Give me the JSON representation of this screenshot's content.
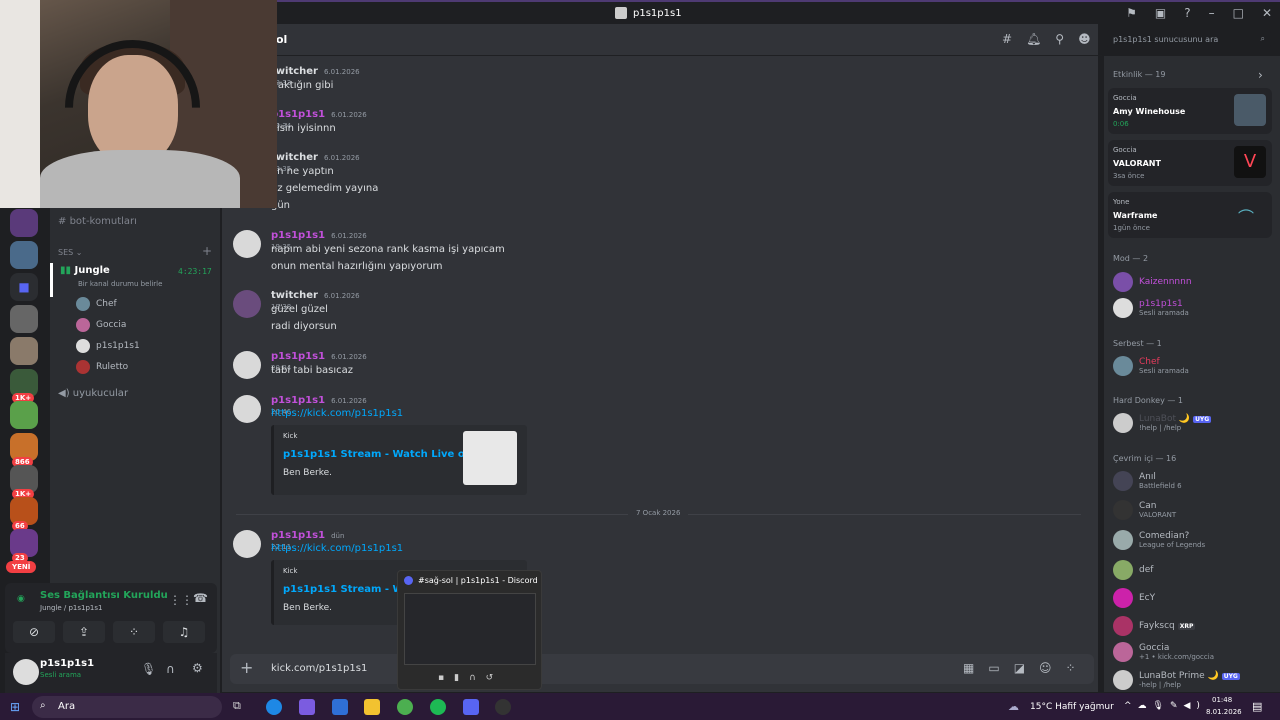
{
  "window": {
    "title": "p1s1p1s1"
  },
  "channel": {
    "name": "ol"
  },
  "search": {
    "placeholder": "p1s1p1s1 sunucusunu ara"
  },
  "sidebar": {
    "text_channel": "bot-komutları",
    "voice_category": "SES",
    "active_voice": {
      "name": "Jungle",
      "timer": "4:23:17",
      "status_prompt": "Bir kanal durumu belirle"
    },
    "voice_users": [
      "Chef",
      "Goccia",
      "p1s1p1s1",
      "Ruletto"
    ],
    "other_voice": "uyukucular",
    "new_label": "YENİ",
    "server_badges": [
      "1K+",
      "1K+",
      "866",
      "1K+",
      "66",
      "23"
    ]
  },
  "voice_status": {
    "title": "Ses Bağlantısı Kuruldu",
    "subtitle": "Jungle / p1s1p1s1"
  },
  "user": {
    "name": "p1s1p1s1",
    "status": "Sesli arama"
  },
  "messages": [
    {
      "author": "twitcher",
      "time": "6.01.2026 19:33",
      "color": "#dbdee1",
      "lines": [
        "ıraktığın gibi"
      ]
    },
    {
      "author": "p1s1p1s1",
      "time": "6.01.2026 19:34",
      "color": "#c150d9",
      "lines": [
        "yisin iyisinnn"
      ]
    },
    {
      "author": "twitcher",
      "time": "6.01.2026 19:35",
      "color": "#dbdee1",
      "lines": [
        "en ne yaptın",
        "üz gelemedim yayına",
        "ğün"
      ]
    },
    {
      "author": "p1s1p1s1",
      "time": "6.01.2026 19:35",
      "color": "#c150d9",
      "lines": [
        "napım abi yeni sezona rank kasma işi yapıcam",
        "onun mental hazırlığını yapıyorum"
      ]
    },
    {
      "author": "twitcher",
      "time": "6.01.2026 19:38",
      "color": "#dbdee1",
      "lines": [
        "güzel güzel",
        "radi diyorsun"
      ]
    },
    {
      "author": "p1s1p1s1",
      "time": "6.01.2026 20:04",
      "color": "#c150d9",
      "lines": [
        "tabi tabi basıcaz"
      ]
    },
    {
      "author": "p1s1p1s1",
      "time": "6.01.2026 20:46",
      "color": "#c150d9",
      "link": "https://kick.com/p1s1p1s1",
      "embed": {
        "provider": "Kick",
        "title": "p1s1p1s1 Stream - Watch Live on Kick",
        "desc": "Ben Berke."
      }
    },
    {
      "author": "p1s1p1s1",
      "time": "dün 22:11",
      "color": "#c150d9",
      "link": "https://kick.com/p1s1p1s1",
      "embed": {
        "provider": "Kick",
        "title": "p1s1p1s1 Stream - Watch L",
        "desc": "Ben Berke."
      }
    }
  ],
  "date_divider": "7 Ocak 2026",
  "input": {
    "value": "kick.com/p1s1p1s1"
  },
  "activity": {
    "header": "Etkinlik — 19",
    "items": [
      {
        "user": "Goccia",
        "title": "Amy Winehouse",
        "sub": "0:06"
      },
      {
        "user": "Goccia",
        "title": "VALORANT",
        "sub": "3sa önce"
      },
      {
        "user": "Yone",
        "title": "Warframe",
        "sub": "1gün önce"
      }
    ]
  },
  "member_sections": [
    {
      "header": "Mod — 2",
      "members": [
        {
          "name": "Kaizennnnn",
          "color": "#c150d9",
          "status": ""
        },
        {
          "name": "p1s1p1s1",
          "color": "#c150d9",
          "status": "Sesli aramada"
        }
      ]
    },
    {
      "header": "Serbest — 1",
      "members": [
        {
          "name": "Chef",
          "color": "#e63b5c",
          "status": "Sesli aramada"
        }
      ]
    },
    {
      "header": "Hard Donkey — 1",
      "members": [
        {
          "name": "LunaBot 🌙",
          "color": "#4e5058",
          "status": "!help | /help",
          "tag": "UYG"
        }
      ]
    },
    {
      "header": "Çevrim içi — 16",
      "members": [
        {
          "name": "Anıl",
          "color": "#b5bac1",
          "status": "Battlefield 6"
        },
        {
          "name": "Can",
          "color": "#b5bac1",
          "status": "VALORANT"
        },
        {
          "name": "Comedian?",
          "color": "#b5bac1",
          "status": "League of Legends"
        },
        {
          "name": "def",
          "color": "#b5bac1",
          "status": ""
        },
        {
          "name": "EcY",
          "color": "#b5bac1",
          "status": ""
        },
        {
          "name": "Faykscq",
          "color": "#b5bac1",
          "status": "",
          "tag": "XRP"
        },
        {
          "name": "Goccia",
          "color": "#b5bac1",
          "status": "+1 • kick.com/goccia"
        },
        {
          "name": "LunaBot Prime 🌙",
          "color": "#b5bac1",
          "status": "-help | /help",
          "tag": "UYG"
        }
      ]
    }
  ],
  "popup": {
    "title": "#sağ-sol | p1s1p1s1 - Discord"
  },
  "taskbar": {
    "search": "Ara",
    "weather": "15°C  Hafif yağmur",
    "time": "01:48",
    "date": "8.01.2026"
  }
}
